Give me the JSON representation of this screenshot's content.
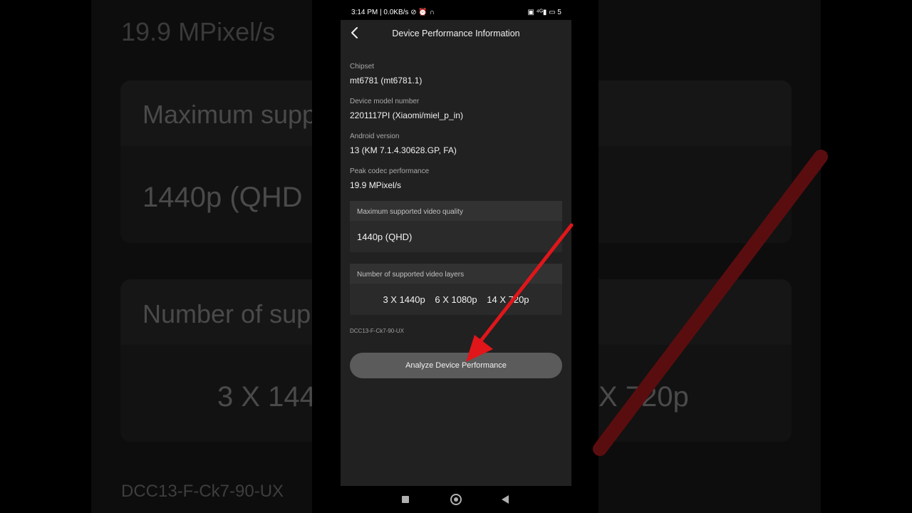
{
  "status_bar": {
    "left": "3:14 PM | 0.0KB/s ⊘ ⏰ ∩",
    "right": "▣ ⁴ᴳ▮ ▭ 5"
  },
  "header": {
    "title": "Device Performance Information"
  },
  "fields": [
    {
      "label": "Chipset",
      "value": "mt6781 (mt6781.1)"
    },
    {
      "label": "Device model number",
      "value": "2201117PI (Xiaomi/miel_p_in)"
    },
    {
      "label": "Android version",
      "value": "13 (KM 7.1.4.30628.GP, FA)"
    },
    {
      "label": "Peak codec performance",
      "value": "19.9 MPixel/s"
    }
  ],
  "max_quality": {
    "label": "Maximum supported video quality",
    "value": "1440p (QHD)"
  },
  "video_layers": {
    "label": "Number of supported video layers",
    "items": [
      "3 X 1440p",
      "6 X 1080p",
      "14 X 720p"
    ]
  },
  "device_code": "DCC13-F-Ck7-90-UX",
  "analyze_button": {
    "label": "Analyze Device Performance"
  },
  "background": {
    "peak": "19.9 MPixel/s",
    "max_quality_label": "Maximum supp",
    "max_quality_value": "1440p (QHD",
    "layers_label": "Number of supp",
    "layers_left": "3 X 144",
    "layers_right": "X 720p",
    "code": "DCC13-F-Ck7-90-UX"
  },
  "colors": {
    "arrow": "#e0161a",
    "arrow_bg": "#5a0d0f",
    "app_bg": "#212121",
    "button_bg": "#5b5b5b"
  },
  "icons": {
    "back": "chevron-left-icon",
    "nav_recents": "square-icon",
    "nav_home": "circle-icon",
    "nav_back": "triangle-icon"
  }
}
